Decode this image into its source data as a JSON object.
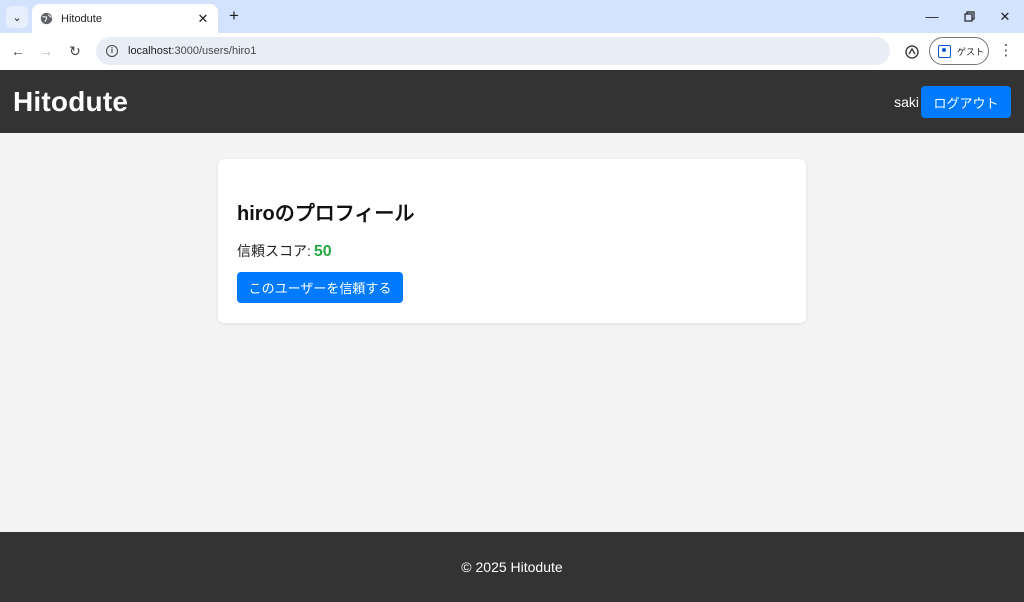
{
  "browser": {
    "tab_title": "Hitodute",
    "url_host": "localhost",
    "url_path": ":3000/users/hiro1",
    "profile_label": "ゲスト"
  },
  "header": {
    "brand": "Hitodute",
    "username": "saki",
    "logout_label": "ログアウト"
  },
  "profile": {
    "title": "hiroのプロフィール",
    "score_label": "信頼スコア:",
    "score_value": "50",
    "trust_button_label": "このユーザーを信頼する"
  },
  "footer": {
    "copyright": "© 2025 Hitodute"
  },
  "colors": {
    "header_bg": "#333333",
    "page_bg": "#f4f4f4",
    "primary_button": "#007bff",
    "score_green": "#28a745",
    "browser_tabbar": "#d3e3fd"
  }
}
